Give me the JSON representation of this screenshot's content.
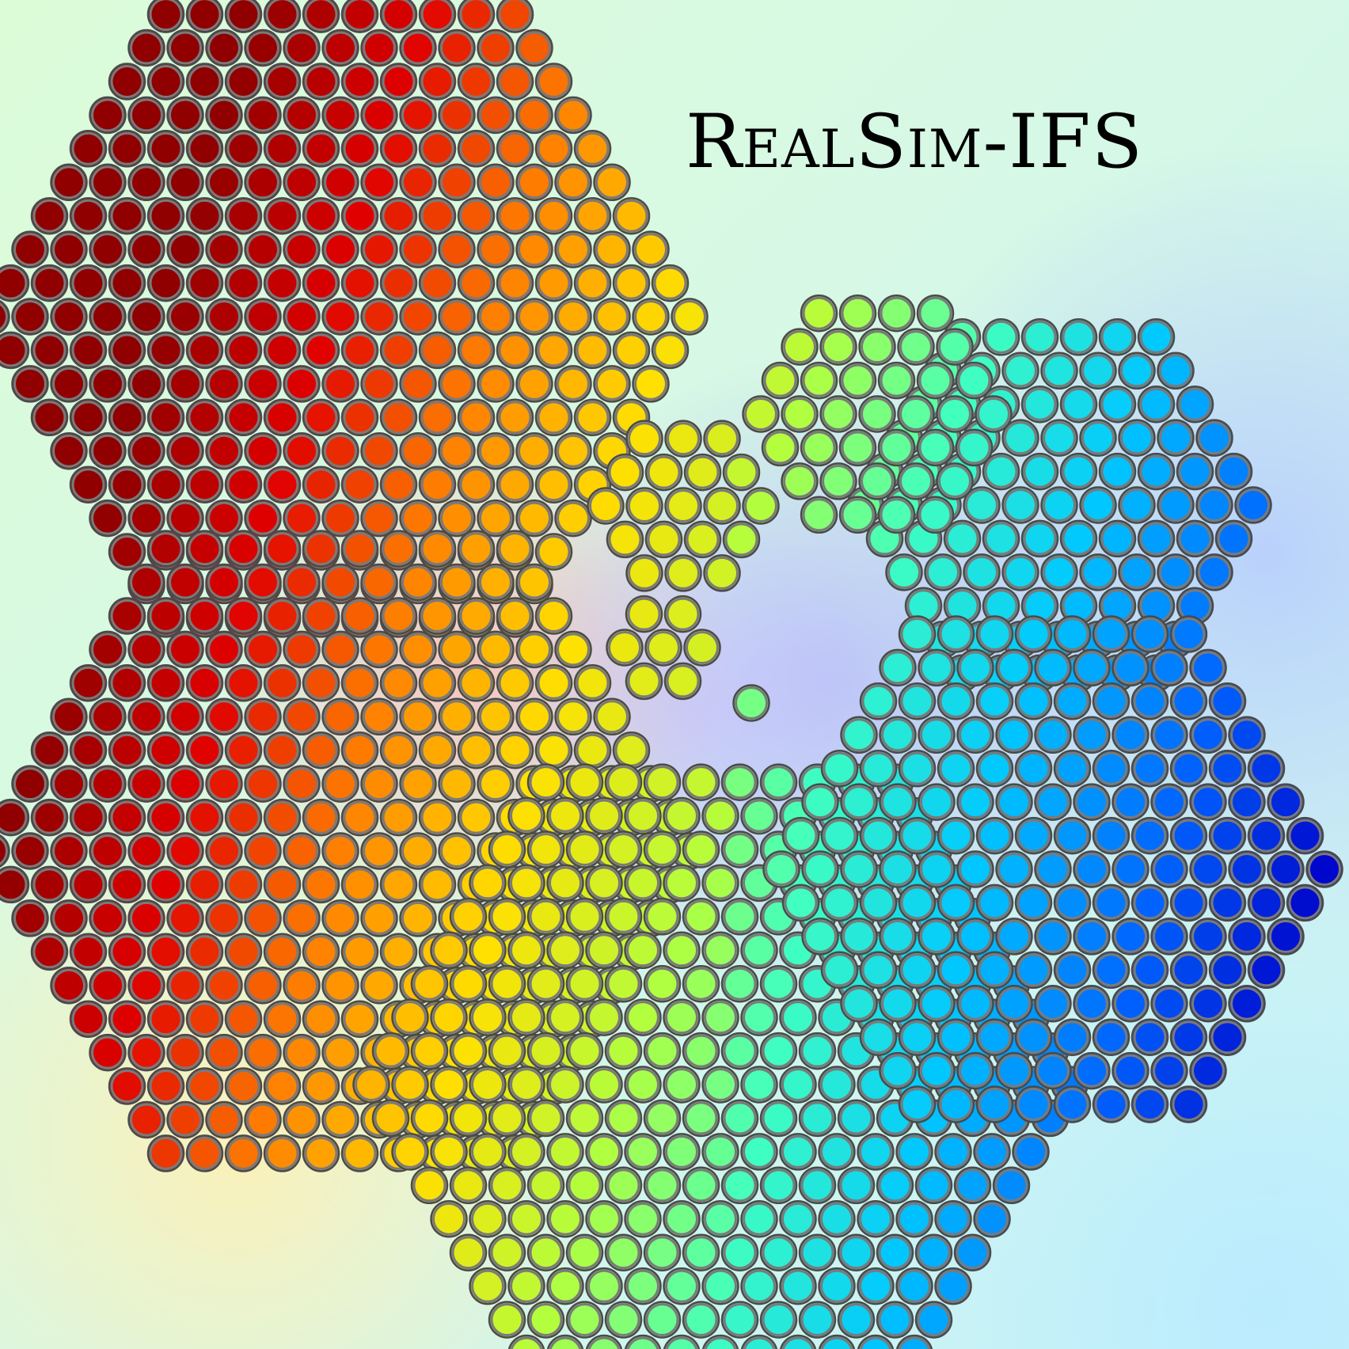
{
  "title": "RealSim-IFS",
  "fiber_bundles": [
    {
      "name": "large-bundle-top-left",
      "rings": 10
    },
    {
      "name": "large-bundle-bottom-left",
      "rings": 10
    },
    {
      "name": "large-bundle-bottom-center",
      "rings": 10
    },
    {
      "name": "medium-bundle-right-top",
      "rings": 6
    },
    {
      "name": "medium-bundle-right-bottom",
      "rings": 8
    },
    {
      "name": "medium-bundle-top-center",
      "rings": 4
    },
    {
      "name": "small-bundle-19",
      "rings": 3
    },
    {
      "name": "small-bundle-7",
      "rings": 2
    },
    {
      "name": "single-fiber",
      "rings": 1
    }
  ],
  "colors": {
    "fiber_outline": "#4a4a4a",
    "fiber_ring": "#7a7a7a",
    "colormap": [
      "#0000c8",
      "#0064ff",
      "#00c8ff",
      "#40ffc0",
      "#b0ff40",
      "#ffe000",
      "#ff8000",
      "#e00000",
      "#900000"
    ]
  }
}
